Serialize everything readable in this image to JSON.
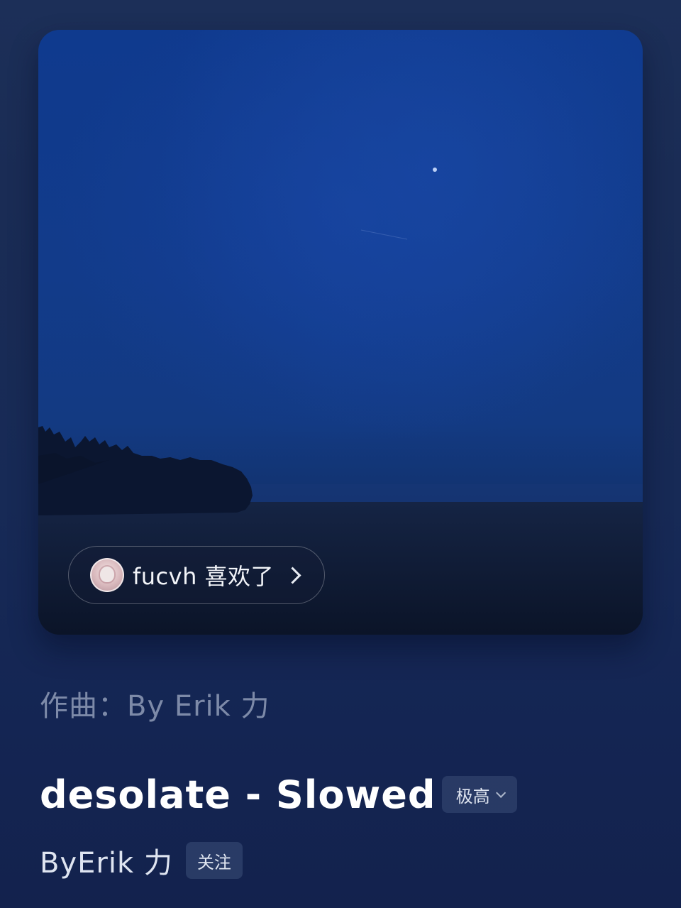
{
  "cover": {
    "liked_by": {
      "text": "fucvh 喜欢了",
      "avatar_icon": "user-avatar",
      "chevron_icon": "chevron-right-icon"
    }
  },
  "composer": "作曲：By Erik 力",
  "song": {
    "title": "desolate - Slowed",
    "quality": "极高",
    "quality_chevron_icon": "chevron-down-icon",
    "artist": "ByErik 力",
    "follow_label": "关注"
  },
  "colors": {
    "background": "#172a56",
    "sky": "#123b8a",
    "text_primary": "#ffffff",
    "text_secondary": "#7d8aa8"
  }
}
